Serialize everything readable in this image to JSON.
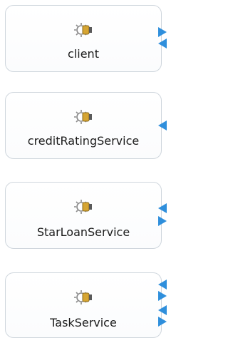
{
  "components": [
    {
      "id": "client",
      "name": "client",
      "icon": "gear-component-icon"
    },
    {
      "id": "creditRatingService",
      "name": "creditRatingService",
      "icon": "gear-component-icon"
    },
    {
      "id": "StarLoanService",
      "name": "StarLoanService",
      "icon": "gear-component-icon"
    },
    {
      "id": "TaskService",
      "name": "TaskService",
      "icon": "gear-component-icon"
    }
  ],
  "colors": {
    "port": "#2f8fdc",
    "box_border": "#cfd6dd",
    "gear": "#8a8a8a",
    "gear_accent": "#d6a532"
  }
}
